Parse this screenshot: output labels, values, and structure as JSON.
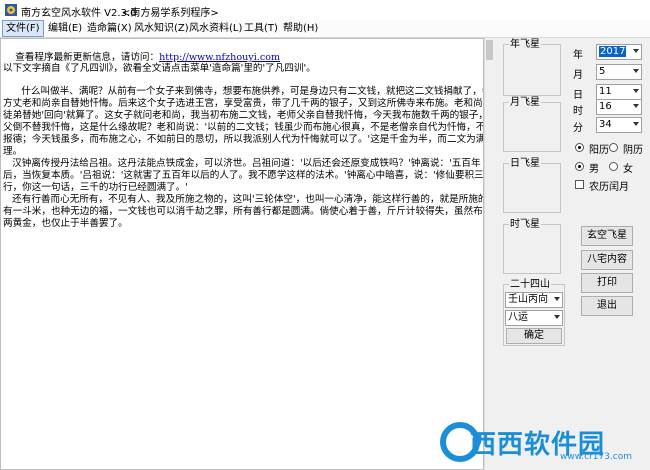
{
  "window": {
    "title": "南方玄空风水软件 V2.3.0",
    "subtitle": "<南方易学系列程序>"
  },
  "menu": {
    "items": [
      "文件(F)",
      "编辑(E)",
      "造命篇(X)",
      "风水知识(Z)",
      "风水资料(L)",
      "工具(T)",
      "帮助(H)"
    ]
  },
  "text": {
    "line0_prefix": "查看程序最新更新信息，请访问：",
    "line0_url": "http://www.nfzhouyi.com",
    "lines": [
      "以下文字摘自《了凡四训》，欲看全文请点击菜单'造命篇'里的'了凡四训'。",
      "      什么叫做半、满呢？从前有一个女子来到佛寺，想要布施供养，可是身边只有二文钱，就把这二文钱捐献了，寺里的",
      "方丈老和尚亲自替她忏悔。后来这个女子选进王宫，享受富贵，带了几千两的银子，又到这所佛寺来布施。老和尚叫他的",
      "徒弟替她'回向'就算了。这女子就问老和尚，我当初布施二文钱，老师父亲自替我忏悔，今天我布施数千两的银子，老师",
      "父倒不替我忏悔，这是什么缘故呢？老和尚说：'以前的二文钱；钱虽少而布施心很真，不是老僧亲自代为忏悔，不足以",
      "报德；今天钱虽多，而布施之心，不如前日的恳切，所以我派别人代为忏悔就可以了。'这是千金为半，而二文为满的道",
      "理。",
      "   汉钟离传授丹法给吕祖。这丹法能点铁成金，可以济世。吕祖问道：'以后还会还原变成铁吗？'钟离说：'五百年",
      "后，当恢复本质。'吕祖说：'这就害了五百年以后的人了。我不愿学这样的法术。'钟离心中暗喜，说：'修仙要积三千功",
      "行，你这一句话，三千的功行已经圆满了。'",
      "   还有行善而心无所有，不见有人、我及所施之物的，这叫'三轮体空'，也叫一心清净，能这样行善的，就是所施的只",
      "有一斗米，也种无边的福，一文钱也可以消千劫之罪，所有善行都是圆满。倘使心着于善，斤斤计较得失，虽然布施了万",
      "两黄金，也仅止于半善罢了。"
    ]
  },
  "panel": {
    "year_star_label": "年飞星",
    "month_star_label": "月飞星",
    "day_star_label": "日飞星",
    "hour_star_label": "时飞星",
    "fields": [
      {
        "label": "年",
        "value": "2017"
      },
      {
        "label": "月",
        "value": "5"
      },
      {
        "label": "日",
        "value": "11"
      },
      {
        "label": "时",
        "value": "16"
      },
      {
        "label": "分",
        "value": "34"
      }
    ],
    "calendar_solar": "阳历",
    "calendar_lunar": "阴历",
    "gender_male": "男",
    "gender_female": "女",
    "leap_month": "农历闰月",
    "mountains_label": "二十四山",
    "mountain_value": "壬山丙向",
    "period_value": "八运",
    "confirm": "确定",
    "btn_xuankong": "玄空飞星",
    "btn_bazhai": "八宅内容",
    "btn_print": "打印",
    "btn_exit": "退出"
  },
  "watermark": {
    "text": "西西软件园",
    "url": "www.cr173.com"
  }
}
